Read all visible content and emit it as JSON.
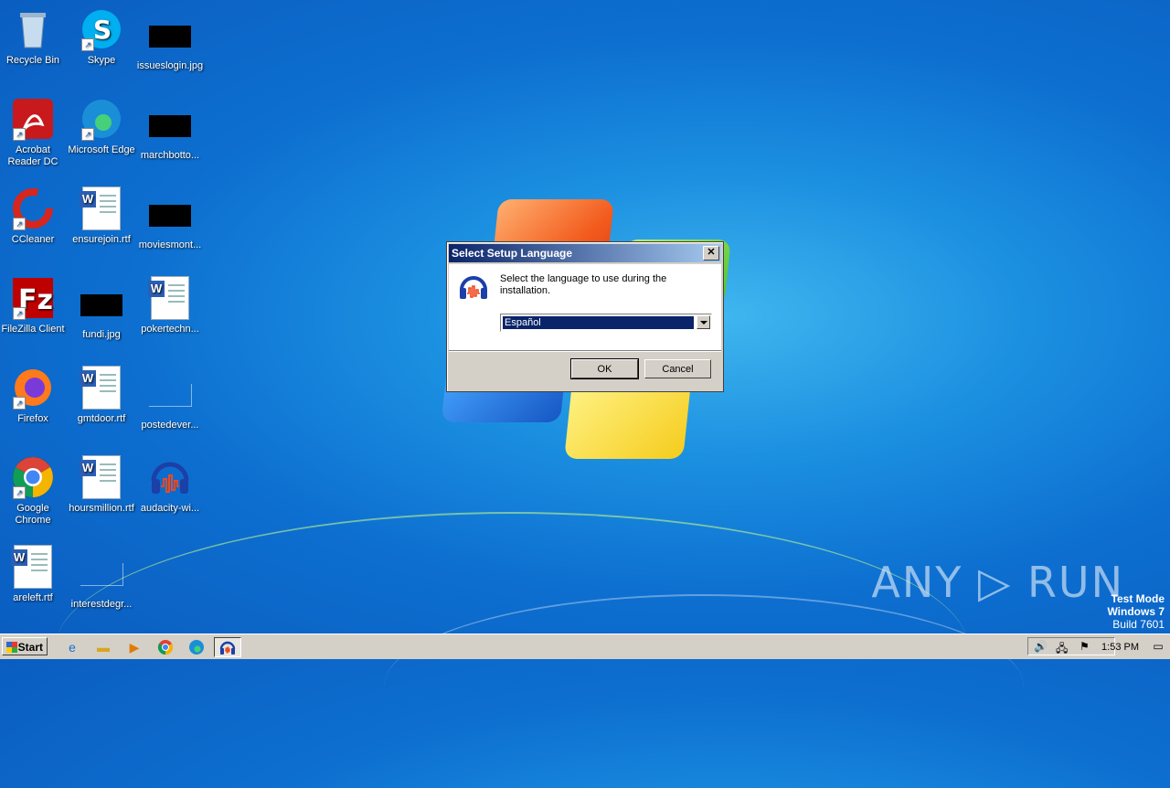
{
  "desktop": {
    "icons": [
      {
        "label": "Recycle Bin"
      },
      {
        "label": "Skype"
      },
      {
        "label": "issueslogin.jpg"
      },
      {
        "label": "Acrobat Reader DC"
      },
      {
        "label": "Microsoft Edge"
      },
      {
        "label": "marchbotto..."
      },
      {
        "label": "CCleaner"
      },
      {
        "label": "ensurejoin.rtf"
      },
      {
        "label": "moviesmont..."
      },
      {
        "label": "FileZilla Client"
      },
      {
        "label": "fundi.jpg"
      },
      {
        "label": "pokertechn..."
      },
      {
        "label": "Firefox"
      },
      {
        "label": "gmtdoor.rtf"
      },
      {
        "label": "postedever..."
      },
      {
        "label": "Google Chrome"
      },
      {
        "label": "hoursmillion.rtf"
      },
      {
        "label": "audacity-wi..."
      },
      {
        "label": "areleft.rtf"
      },
      {
        "label": "interestdegr..."
      }
    ]
  },
  "dialog": {
    "title": "Select Setup Language",
    "close": "✕",
    "message": "Select the language to use during the installation.",
    "language_selected": "Español",
    "ok_label": "OK",
    "cancel_label": "Cancel"
  },
  "watermark": {
    "brand": "ANY ▷ RUN",
    "test_mode": "Test Mode",
    "os": "Windows 7",
    "build": "Build 7601"
  },
  "taskbar": {
    "start_label": "Start",
    "clock": "1:53 PM"
  },
  "colors": {
    "wallpaper": "#0d6fd0",
    "titlebar": "#0a246a",
    "selection": "#0a246a"
  }
}
